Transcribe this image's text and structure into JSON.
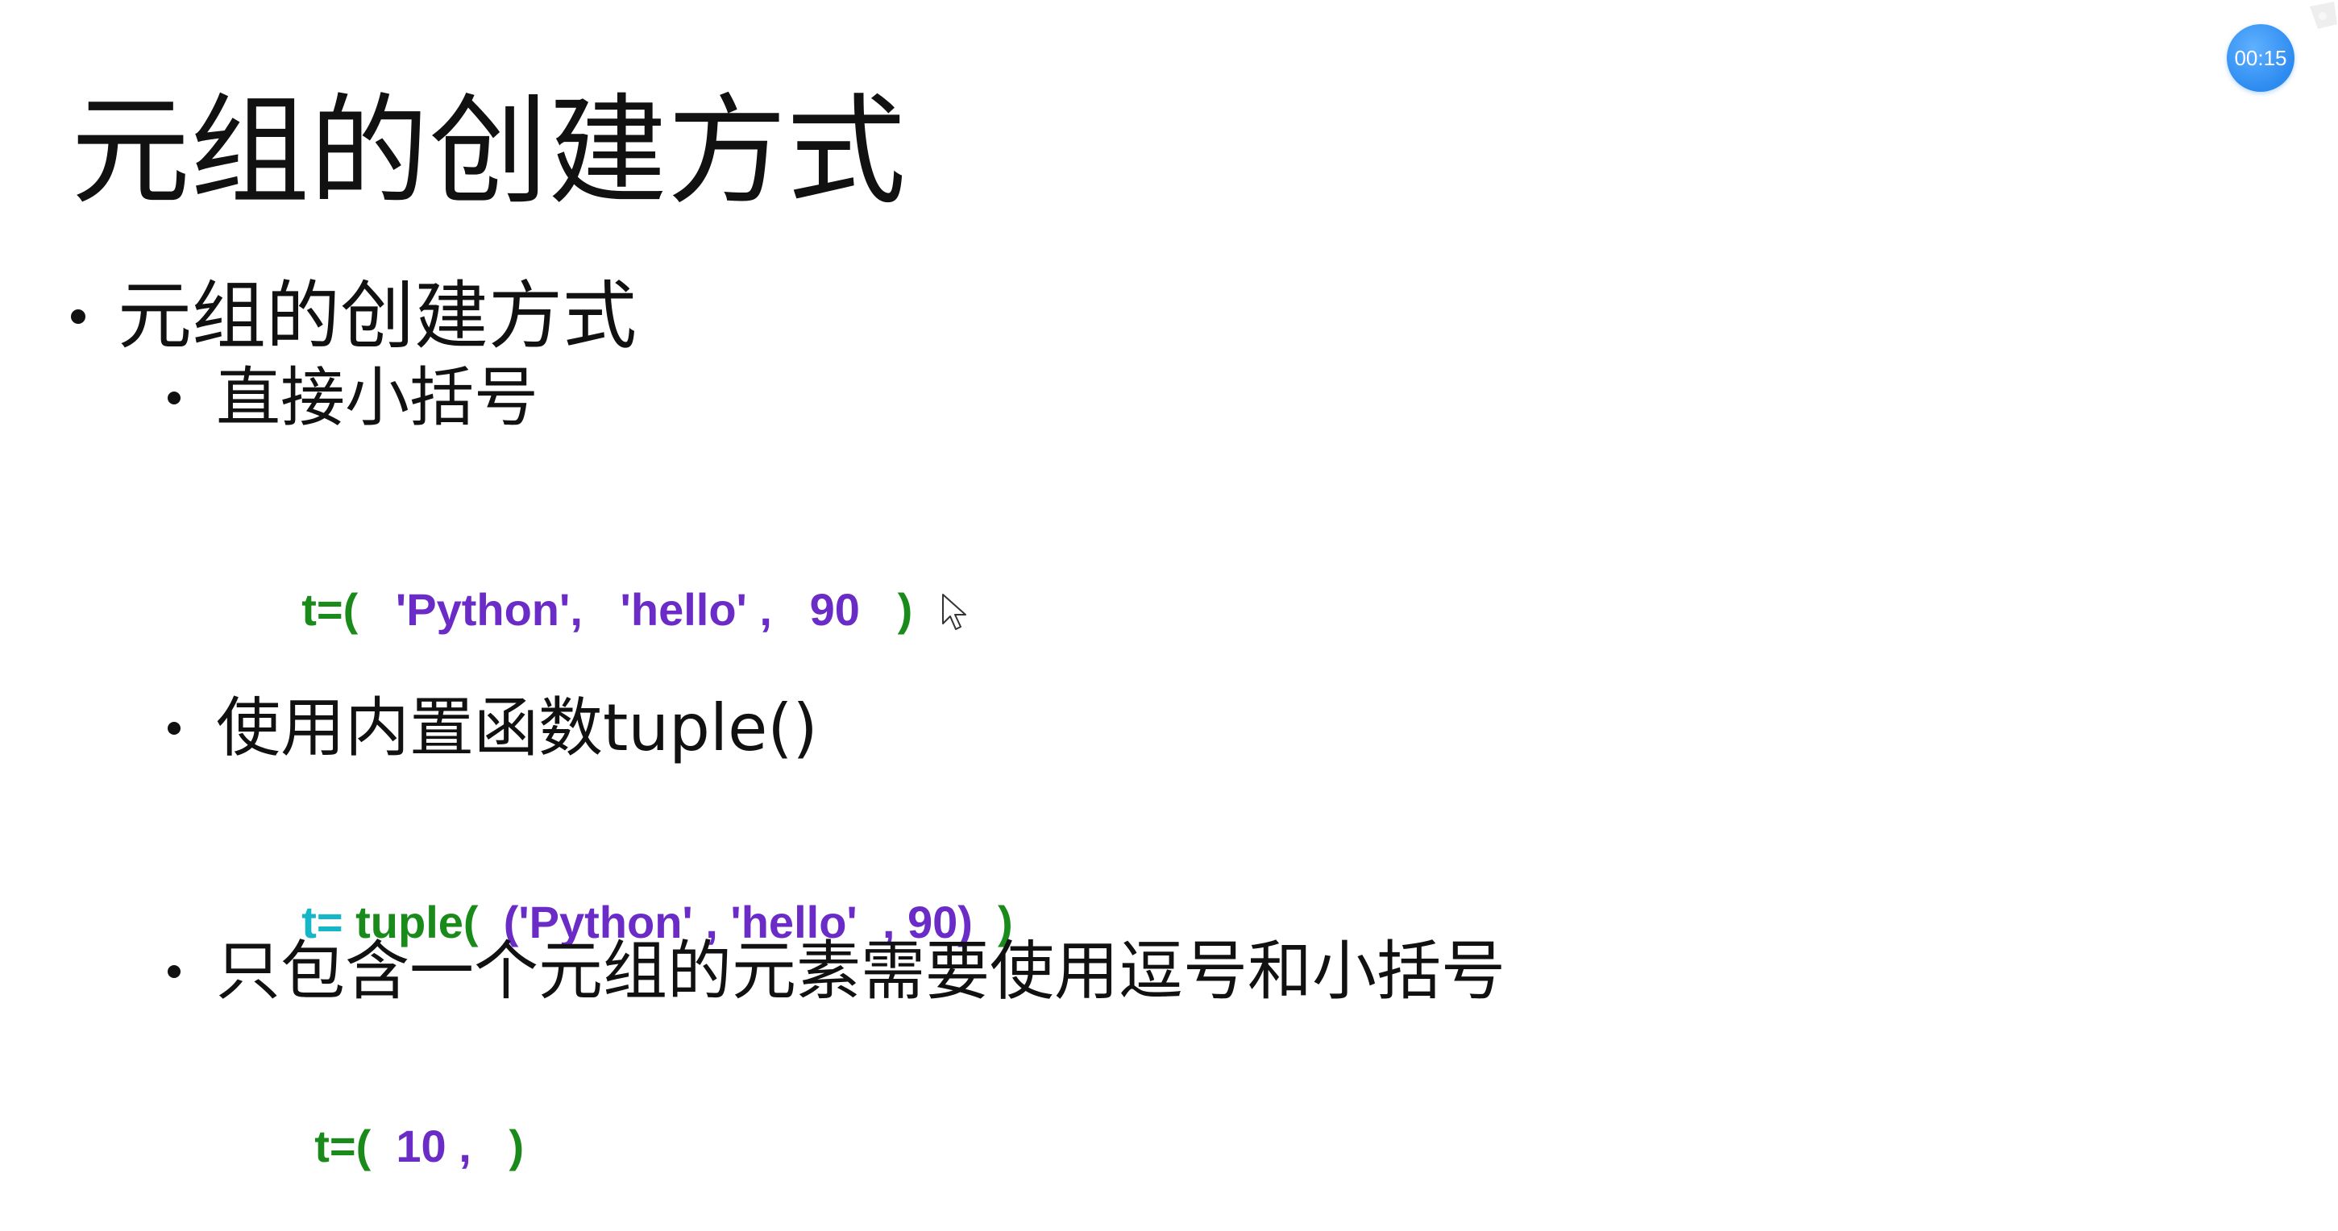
{
  "slide": {
    "title": "元组的创建方式",
    "level1_bullet": "元组的创建方式",
    "items": [
      {
        "label": "直接小括号",
        "code": [
          {
            "text": "t=(   ",
            "color": "green"
          },
          {
            "text": "'Python',   'hello' ,   90",
            "color": "purple"
          },
          {
            "text": "   )",
            "color": "green"
          }
        ]
      },
      {
        "label": "使用内置函数tuple()",
        "code": [
          {
            "text": "t= ",
            "color": "cyan"
          },
          {
            "text": "tuple(  ",
            "color": "green"
          },
          {
            "text": "('Python' , 'hello'  , 90)",
            "color": "purple"
          },
          {
            "text": "  )",
            "color": "green"
          }
        ]
      },
      {
        "label": "只包含一个元组的元素需要使用逗号和小括号",
        "code": [
          {
            "text": "t=(  ",
            "color": "green"
          },
          {
            "text": "10 ,",
            "color": "purple"
          },
          {
            "text": "   )",
            "color": "green"
          }
        ]
      }
    ]
  },
  "overlay": {
    "timer_text": "00:15",
    "timer_color": "#2d8bf0",
    "logo_icon": "bilibili-logo-icon",
    "cursor_icon": "mouse-pointer-icon"
  },
  "colors": {
    "code_green": "#1a8a1a",
    "code_purple": "#6a2bc6",
    "code_cyan": "#14b6c8"
  }
}
